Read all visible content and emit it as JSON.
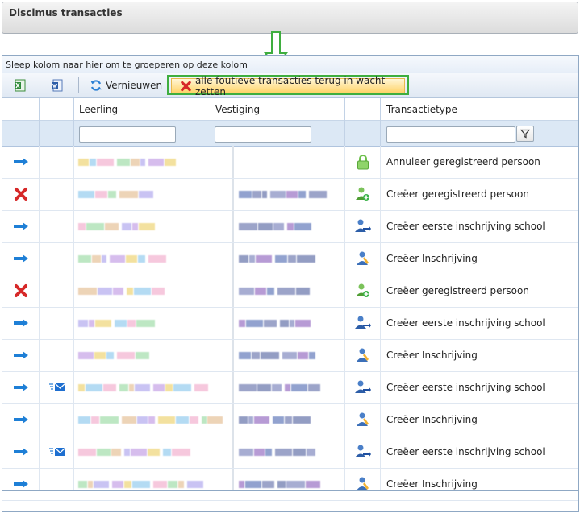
{
  "window": {
    "title": "Discimus transacties"
  },
  "grid": {
    "group_panel_text": "Sleep kolom naar hier om te groeperen op deze kolom",
    "toolbar": {
      "refresh_label": "Vernieuwen",
      "retry_label": "alle foutieve transacties terug in wacht zetten"
    },
    "columns": [
      "Leerling",
      "Vestiging",
      "Transactietype"
    ],
    "rows": [
      {
        "status": "arrow",
        "mail": false,
        "icon": "lock",
        "type": "Annuleer geregistreerd persoon"
      },
      {
        "status": "error",
        "mail": false,
        "icon": "person-add",
        "type": "Creëer geregistreerd persoon"
      },
      {
        "status": "arrow",
        "mail": false,
        "icon": "person-school",
        "type": "Creëer eerste inschrijving school"
      },
      {
        "status": "arrow",
        "mail": false,
        "icon": "person-enroll",
        "type": "Creëer Inschrijving"
      },
      {
        "status": "error",
        "mail": false,
        "icon": "person-add",
        "type": "Creëer geregistreerd persoon"
      },
      {
        "status": "arrow",
        "mail": false,
        "icon": "person-school",
        "type": "Creëer eerste inschrijving school"
      },
      {
        "status": "arrow",
        "mail": false,
        "icon": "person-enroll",
        "type": "Creëer Inschrijving"
      },
      {
        "status": "arrow",
        "mail": true,
        "icon": "person-school",
        "type": "Creëer eerste inschrijving school"
      },
      {
        "status": "arrow",
        "mail": false,
        "icon": "person-enroll",
        "type": "Creëer Inschrijving"
      },
      {
        "status": "arrow",
        "mail": true,
        "icon": "person-school",
        "type": "Creëer eerste inschrijving school"
      },
      {
        "status": "arrow",
        "mail": false,
        "icon": "person-enroll",
        "type": "Creëer Inschrijving"
      }
    ]
  },
  "colors": {
    "accent_highlight": "#3fae3f",
    "header_bg": "#dce8f5",
    "arrow": "#1e7fd6",
    "error": "#d62828"
  }
}
